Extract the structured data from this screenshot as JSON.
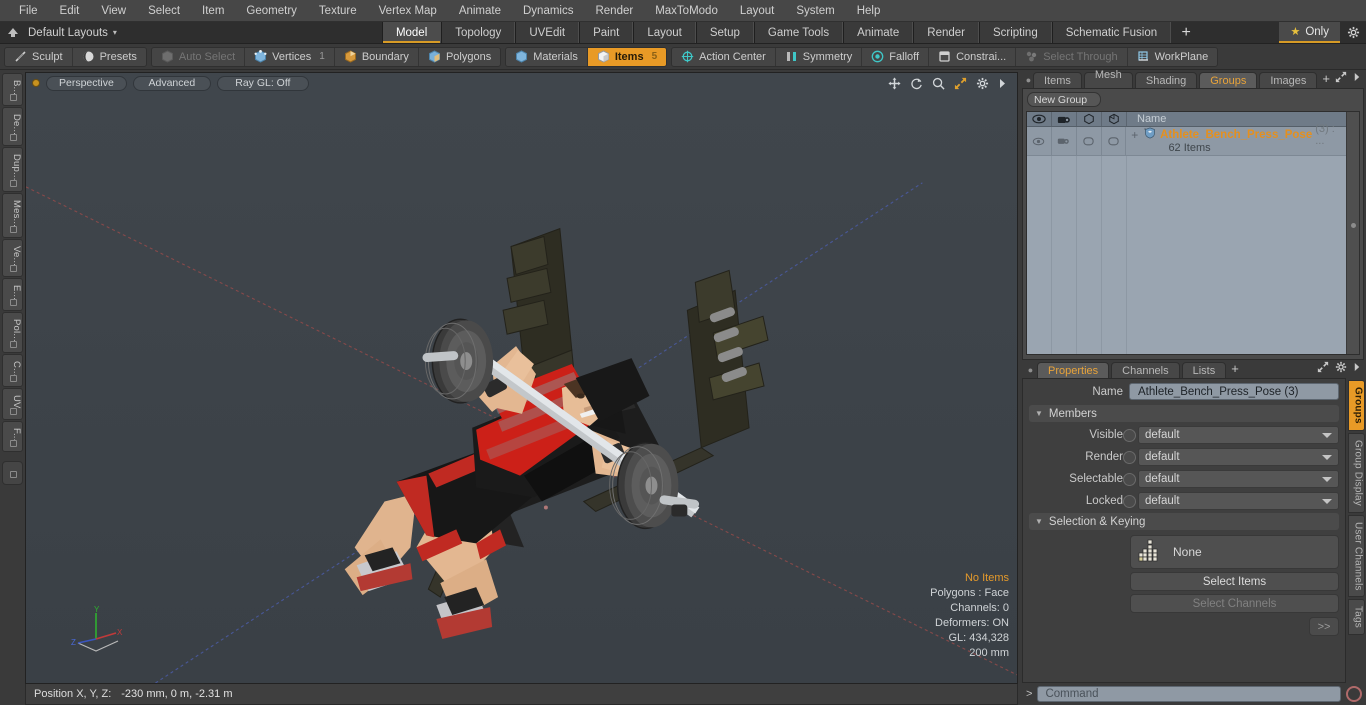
{
  "menu": {
    "items": [
      "File",
      "Edit",
      "View",
      "Select",
      "Item",
      "Geometry",
      "Texture",
      "Vertex Map",
      "Animate",
      "Dynamics",
      "Render",
      "MaxToModo",
      "Layout",
      "System",
      "Help"
    ]
  },
  "layoutbar": {
    "home_icon": "home-icon",
    "layouts_label": "Default Layouts",
    "caret": "▾",
    "tabs": [
      {
        "label": "Model",
        "active": true
      },
      {
        "label": "Topology",
        "active": false
      },
      {
        "label": "UVEdit",
        "active": false
      },
      {
        "label": "Paint",
        "active": false
      },
      {
        "label": "Layout",
        "active": false
      },
      {
        "label": "Setup",
        "active": false
      },
      {
        "label": "Game Tools",
        "active": false
      },
      {
        "label": "Animate",
        "active": false
      },
      {
        "label": "Render",
        "active": false
      },
      {
        "label": "Scripting",
        "active": false
      },
      {
        "label": "Schematic Fusion",
        "active": false
      }
    ],
    "add_tab": "+",
    "only_label": "Only",
    "only_star": "★",
    "gear_icon": "gear-icon"
  },
  "toolbar": {
    "group1": [
      {
        "label": "Sculpt",
        "icon": "sculpt-brush-icon",
        "state": "normal",
        "badge": ""
      },
      {
        "label": "Presets",
        "icon": "presets-sphere-icon",
        "state": "normal",
        "badge": ""
      }
    ],
    "group2": [
      {
        "label": "Auto Select",
        "icon": "cube-grey-icon",
        "state": "dim",
        "badge": ""
      },
      {
        "label": "Vertices",
        "icon": "cube-vertices-icon",
        "state": "normal",
        "badge": "1"
      },
      {
        "label": "Boundary",
        "icon": "cube-boundary-icon",
        "state": "normal",
        "badge": ""
      },
      {
        "label": "Polygons",
        "icon": "cube-polygons-icon",
        "state": "normal",
        "badge": ""
      }
    ],
    "group3": [
      {
        "label": "Materials",
        "icon": "cube-materials-icon",
        "state": "normal",
        "badge": ""
      },
      {
        "label": "Items",
        "icon": "cube-items-icon",
        "state": "active",
        "badge": "5"
      }
    ],
    "group4": [
      {
        "label": "Action Center",
        "icon": "action-center-icon",
        "state": "normal",
        "badge": ""
      },
      {
        "label": "Symmetry",
        "icon": "symmetry-icon",
        "state": "normal",
        "badge": ""
      },
      {
        "label": "Falloff",
        "icon": "falloff-icon",
        "state": "normal",
        "badge": ""
      },
      {
        "label": "Constrai...",
        "icon": "constraint-icon",
        "state": "normal",
        "badge": ""
      },
      {
        "label": "Select Through",
        "icon": "select-through-icon",
        "state": "dim",
        "badge": ""
      },
      {
        "label": "WorkPlane",
        "icon": "workplane-icon",
        "state": "normal",
        "badge": ""
      }
    ]
  },
  "left_rail": {
    "tabs": [
      "B...",
      "De...",
      "Dup...",
      "Mes...",
      "Ve...",
      "E...",
      "Pol...",
      "C...",
      "UV",
      "F..."
    ]
  },
  "viewport": {
    "buttons": [
      "Perspective",
      "Advanced",
      "Ray GL: Off"
    ],
    "header_icons": [
      "move-icon",
      "rotate-icon",
      "zoom-icon",
      "fullscreen-icon",
      "gear-icon",
      "chevron-right-icon"
    ],
    "stats": [
      {
        "text": "No Items",
        "highlight": true
      },
      {
        "text": "Polygons : Face",
        "highlight": false
      },
      {
        "text": "Channels: 0",
        "highlight": false
      },
      {
        "text": "Deformers: ON",
        "highlight": false
      },
      {
        "text": "GL: 434,328",
        "highlight": false
      },
      {
        "text": "200 mm",
        "highlight": false
      }
    ],
    "axis": {
      "x": "X",
      "y": "Y",
      "z": "Z"
    },
    "scene_description": "Athlete bench press pose — 3D character on weight bench with barbell"
  },
  "statusbar": {
    "label": "Position X, Y, Z:",
    "value": "-230 mm, 0 m, -2.31 m"
  },
  "right_panel": {
    "tabs": [
      {
        "label": "Items",
        "active": false
      },
      {
        "label": "Mesh ...",
        "active": false
      },
      {
        "label": "Shading",
        "active": false
      },
      {
        "label": "Groups",
        "active": true
      },
      {
        "label": "Images",
        "active": false
      }
    ],
    "add_tab": "+",
    "icons": [
      "expand-icon",
      "chevron-right-icon"
    ],
    "new_group_button": "New Group",
    "list": {
      "column_icons": [
        "eye-icon",
        "render-camera-icon",
        "selectable-cube-icon",
        "locked-cube-icon"
      ],
      "name_header": "Name",
      "rows": [
        {
          "expander": "+",
          "group_icon": "group-shield-icon",
          "name": "Athlete_Bench_Press_Pose",
          "suffix": "(3) : ...",
          "subtitle": "62 Items"
        }
      ]
    }
  },
  "properties": {
    "tabs": [
      {
        "label": "Properties",
        "active": true
      },
      {
        "label": "Channels",
        "active": false
      },
      {
        "label": "Lists",
        "active": false
      }
    ],
    "add_tab": "+",
    "icons": [
      "expand-icon",
      "gear-icon",
      "chevron-right-icon"
    ],
    "name_label": "Name",
    "name_value": "Athlete_Bench_Press_Pose (3)",
    "sections": [
      {
        "title": "Members",
        "tri": "▼",
        "rows": [
          {
            "label": "Visible",
            "value": "default"
          },
          {
            "label": "Render",
            "value": "default"
          },
          {
            "label": "Selectable",
            "value": "default"
          },
          {
            "label": "Locked",
            "value": "default"
          }
        ]
      },
      {
        "title": "Selection & Keying",
        "tri": "▼",
        "picker": {
          "icon": "selection-matrix-icon",
          "value": "None"
        },
        "buttons": [
          {
            "label": "Select Items",
            "enabled": true
          },
          {
            "label": "Select Channels",
            "enabled": false
          }
        ],
        "chevron": ">>"
      }
    ]
  },
  "right_rail": {
    "tabs": [
      {
        "label": "Groups",
        "active": true
      },
      {
        "label": "Group Display",
        "active": false
      },
      {
        "label": "User Channels",
        "active": false
      },
      {
        "label": "Tags",
        "active": false
      }
    ]
  },
  "command_bar": {
    "prompt": ">",
    "placeholder": "Command",
    "record_icon": "record-circle-icon"
  },
  "colors": {
    "accent_orange": "#e89a26",
    "tab_underline": "#d79b26",
    "panel_bg": "#3a3a3a",
    "viewport_bg": "#3e444a",
    "list_bg": "#9aa5b1",
    "field_bg": "#8f99a4"
  }
}
